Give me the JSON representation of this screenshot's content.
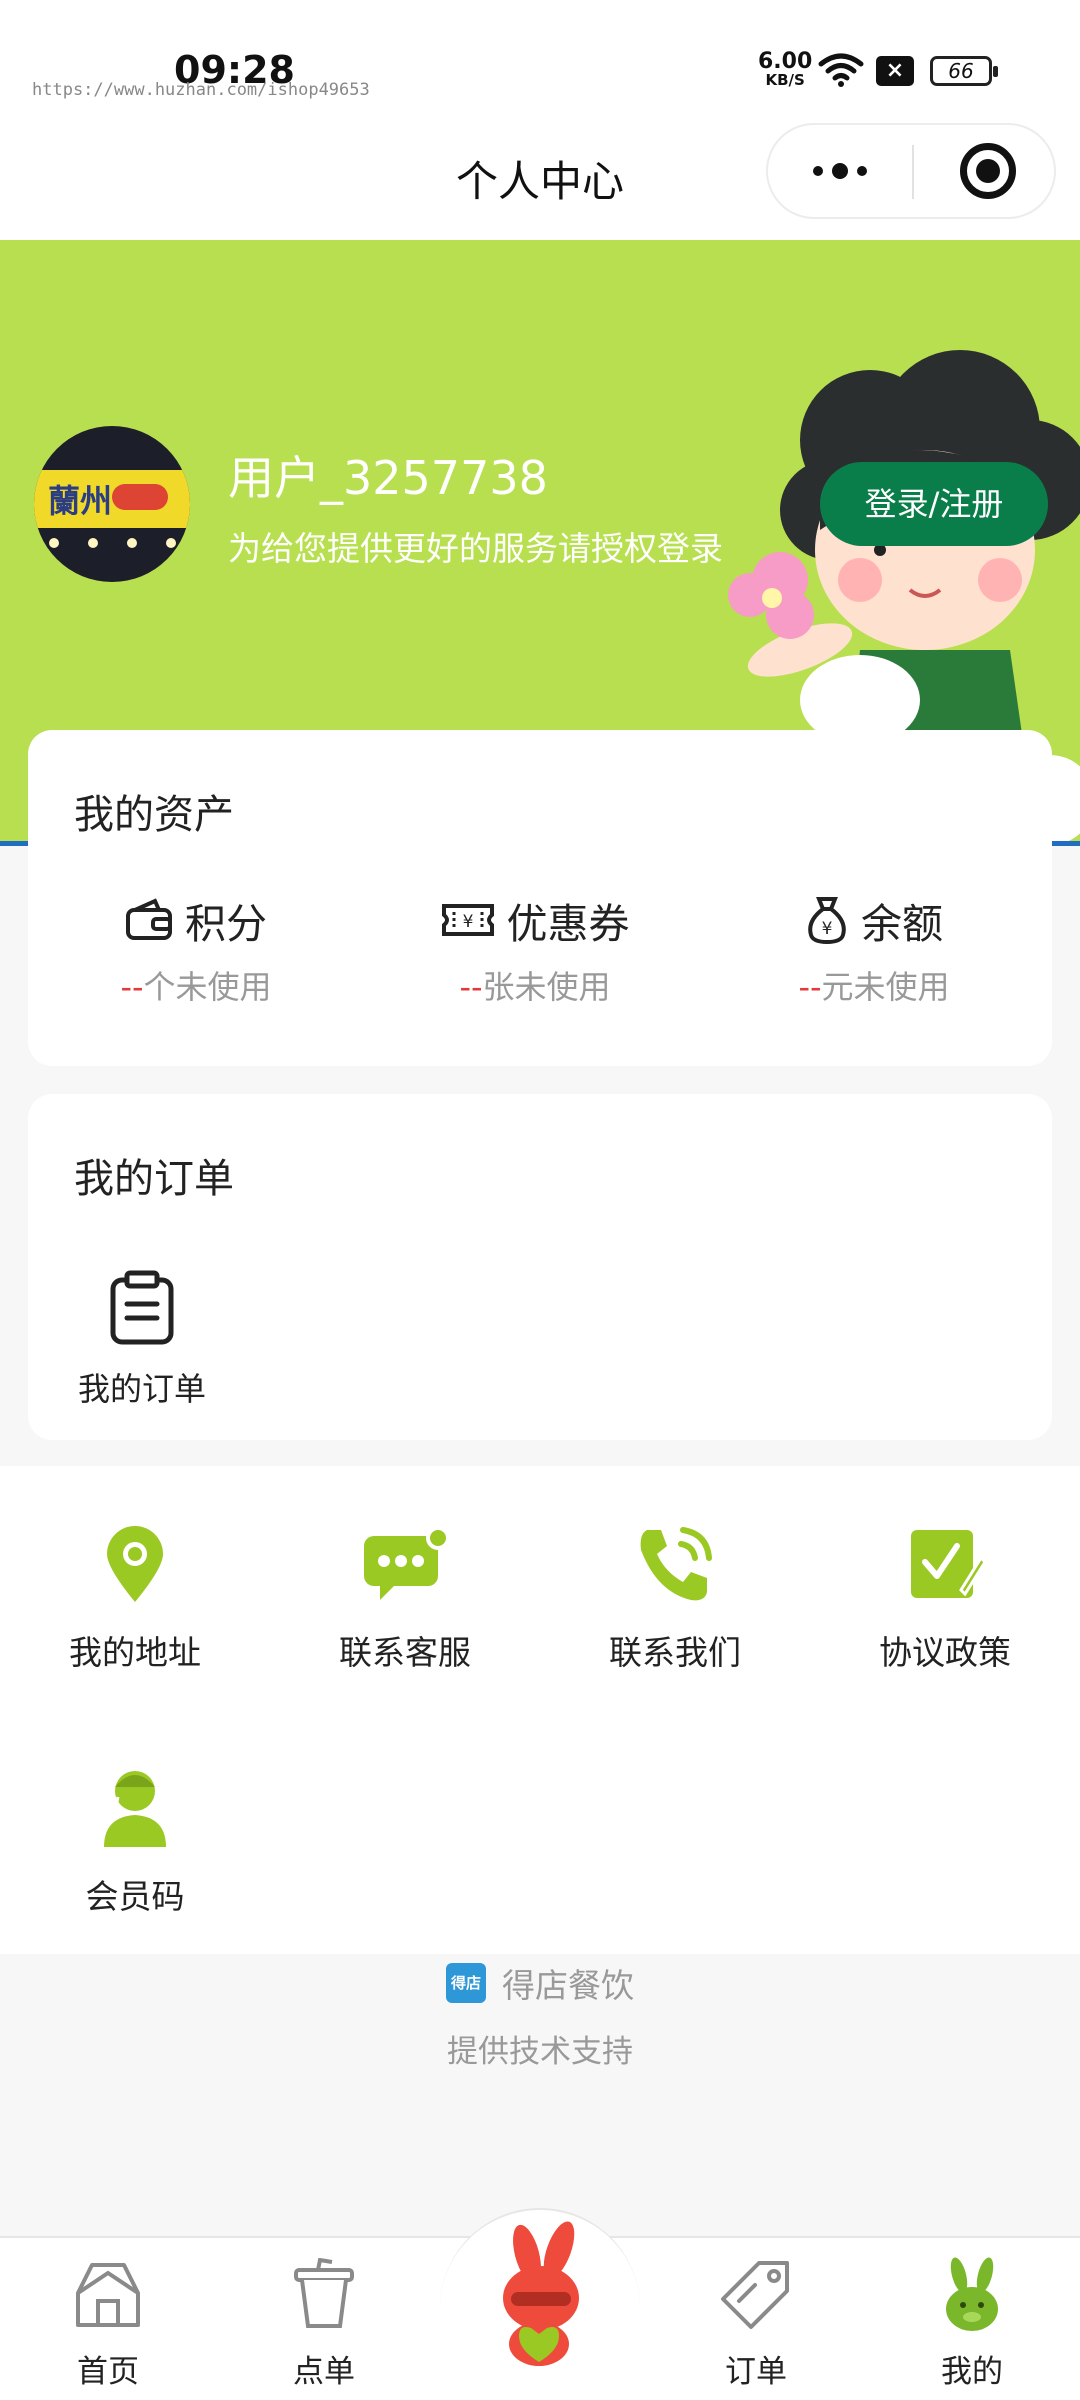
{
  "status_bar": {
    "time": "09:28",
    "watermark": "https://www.huzhan.com/ishop49653",
    "net_speed": "6.00",
    "net_unit": "KB/S",
    "battery": "66"
  },
  "nav": {
    "title": "个人中心"
  },
  "profile": {
    "username": "用户_3257738",
    "auth_hint": "为给您提供更好的服务请授权登录",
    "login_button": "登录/注册",
    "avatar_sign": "蘭州"
  },
  "assets": {
    "title": "我的资产",
    "items": [
      {
        "label": "积分",
        "dash": "--",
        "sub": "个未使用",
        "icon": "wallet-icon"
      },
      {
        "label": "优惠券",
        "dash": "--",
        "sub": "张未使用",
        "icon": "coupon-icon"
      },
      {
        "label": "余额",
        "dash": "--",
        "sub": "元未使用",
        "icon": "money-bag-icon"
      }
    ]
  },
  "orders": {
    "title": "我的订单",
    "item_label": "我的订单"
  },
  "services": [
    {
      "label": "我的地址",
      "icon": "location-pin-icon"
    },
    {
      "label": "联系客服",
      "icon": "chat-bubble-icon"
    },
    {
      "label": "联系我们",
      "icon": "phone-icon"
    },
    {
      "label": "协议政策",
      "icon": "document-edit-icon"
    },
    {
      "label": "会员码",
      "icon": "member-icon"
    }
  ],
  "footer": {
    "logo_text": "得店",
    "brand": "得店餐饮",
    "support": "提供技术支持"
  },
  "tabbar": [
    {
      "label": "首页",
      "icon": "home-icon"
    },
    {
      "label": "点单",
      "icon": "cup-icon"
    },
    {
      "label": "",
      "icon": "mascot-icon"
    },
    {
      "label": "订单",
      "icon": "tag-icon"
    },
    {
      "label": "我的",
      "icon": "bunny-icon",
      "active": true
    }
  ],
  "colors": {
    "banner": "#b8df4f",
    "accent_green": "#9bc924",
    "login_button": "#0a7e4a",
    "dash_red": "#e4393c"
  }
}
